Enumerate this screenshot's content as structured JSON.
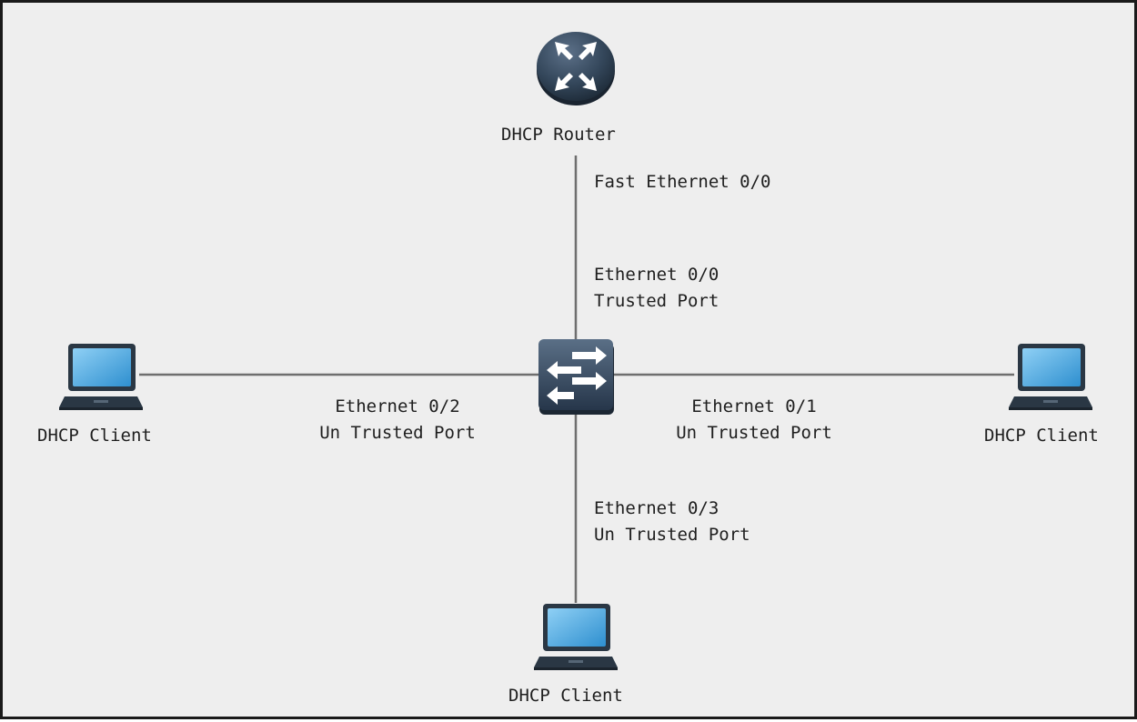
{
  "diagram": {
    "router": {
      "label": "DHCP Router",
      "icon": "router-icon"
    },
    "switch": {
      "icon": "switch-icon"
    },
    "router_interface": "Fast Ethernet 0/0",
    "ports": {
      "uplink": {
        "name": "Ethernet 0/0",
        "trust": "Trusted Port"
      },
      "right": {
        "name": "Ethernet 0/1",
        "trust": "Un Trusted Port"
      },
      "left": {
        "name": "Ethernet 0/2",
        "trust": "Un Trusted Port"
      },
      "bottom": {
        "name": "Ethernet 0/3",
        "trust": "Un Trusted Port"
      }
    },
    "clients": {
      "left": {
        "label": "DHCP Client",
        "icon": "laptop-icon"
      },
      "right": {
        "label": "DHCP Client",
        "icon": "laptop-icon"
      },
      "bottom": {
        "label": "DHCP Client",
        "icon": "laptop-icon"
      }
    },
    "colors": {
      "background": "#eeeeee",
      "link": "#6e6e6e",
      "device_dark": "#2f3d4b",
      "laptop_screen": "#4aa6dc"
    }
  }
}
